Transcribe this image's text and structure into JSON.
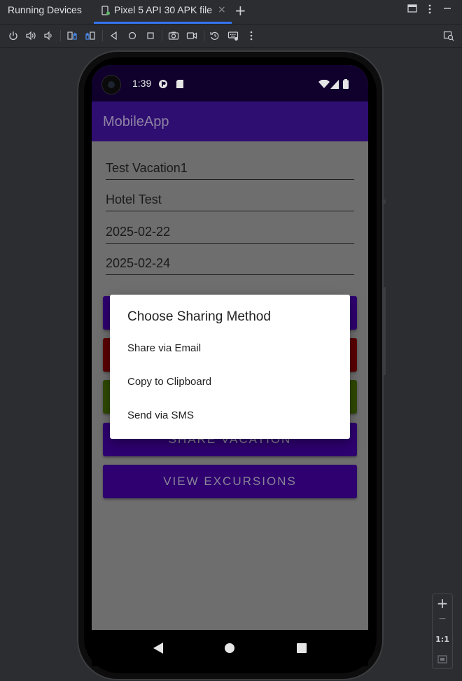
{
  "tool_window": {
    "title": "Running Devices"
  },
  "tab": {
    "label": "Pixel 5 API 30 APK file",
    "close": "×"
  },
  "add_tab": "+",
  "header_icons": {
    "layout": "layout-icon",
    "more": "more-vertical-icon",
    "minimize": "minimize-icon"
  },
  "toolbar": {
    "icons": [
      "power-icon",
      "volume-up-icon",
      "volume-down-icon",
      "rotate-left-icon",
      "rotate-right-icon",
      "back-icon",
      "home-icon",
      "overview-icon",
      "screenshot-icon",
      "screen-record-icon",
      "reset-icon",
      "keyboard-icon",
      "more-options-icon",
      "device-explorer-icon"
    ]
  },
  "phone": {
    "status_bar": {
      "time": "1:39"
    },
    "app_bar": {
      "title": "MobileApp"
    },
    "fields": [
      "Test Vacation1",
      "Hotel Test",
      "2025-02-22",
      "2025-02-24"
    ],
    "buttons": [
      {
        "label": "",
        "color": "#2e0070"
      },
      {
        "label": "",
        "color": "#5a0000"
      },
      {
        "label": "",
        "color": "#2f4900"
      },
      {
        "label": "SHARE VACATION",
        "color": "#2e0070"
      },
      {
        "label": "VIEW EXCURSIONS",
        "color": "#2e0070"
      }
    ],
    "dialog": {
      "title": "Choose Sharing Method",
      "options": [
        "Share via Email",
        "Copy to Clipboard",
        "Send via SMS"
      ]
    }
  },
  "zoom_panel": {
    "zoom_in": "+",
    "zoom_out": "−",
    "actual_size": "1:1"
  }
}
